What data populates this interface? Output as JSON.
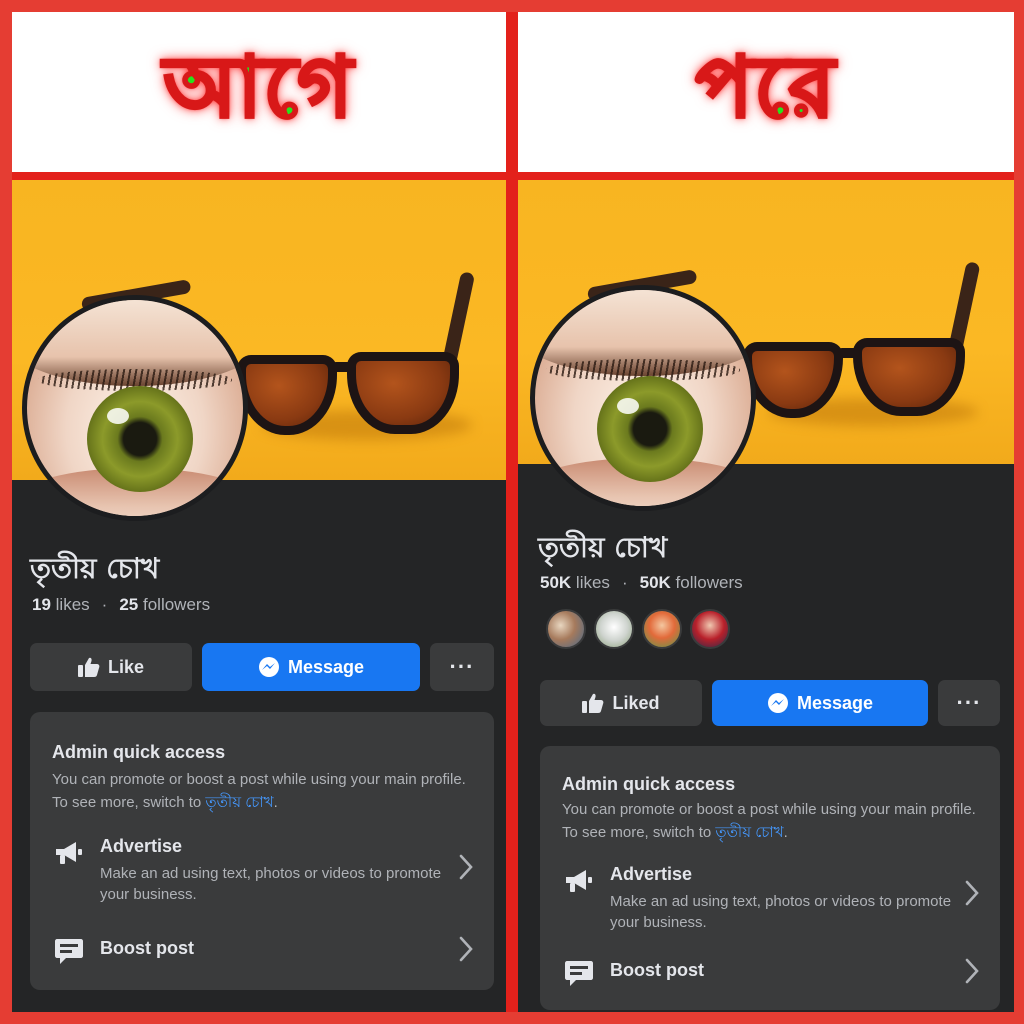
{
  "before": {
    "heading": "আগে",
    "page_name": "তৃতীয় চোখ",
    "likes_count": "19",
    "likes_label": "likes",
    "followers_count": "25",
    "followers_label": "followers",
    "like_button": "Like",
    "message_button": "Message",
    "more_button": "···",
    "admin": {
      "title": "Admin quick access",
      "desc_text": "You can promote or boost a post while using your main profile. To see more, switch to ",
      "desc_link": "তৃতীয় চোখ",
      "desc_end": "."
    },
    "advertise": {
      "title": "Advertise",
      "desc": "Make an ad using text, photos or videos to promote your business."
    },
    "boost": {
      "title": "Boost post"
    }
  },
  "after": {
    "heading": "পরে",
    "page_name": "তৃতীয় চোখ",
    "likes_count": "50K",
    "likes_label": "likes",
    "followers_count": "50K",
    "followers_label": "followers",
    "like_button": "Liked",
    "message_button": "Message",
    "more_button": "···",
    "admin": {
      "title": "Admin quick access",
      "desc_text": "You can promote or boost a post while using your main profile. To see more, switch to ",
      "desc_link": "তৃতীয় চোখ",
      "desc_end": "."
    },
    "advertise": {
      "title": "Advertise",
      "desc": "Make an ad using text, photos or videos to promote your business."
    },
    "boost": {
      "title": "Boost post"
    }
  },
  "colors": {
    "frame_red": "#e53d33",
    "heading_green": "#27e21d",
    "cover_yellow": "#f8b521",
    "fb_dark": "#242526",
    "fb_card": "#3a3b3c",
    "fb_blue": "#1877f2",
    "link_blue": "#4599ff"
  },
  "icons": [
    "thumbs-up-icon",
    "messenger-icon",
    "more-dots-icon",
    "megaphone-icon",
    "boost-post-icon",
    "chevron-right-icon"
  ]
}
